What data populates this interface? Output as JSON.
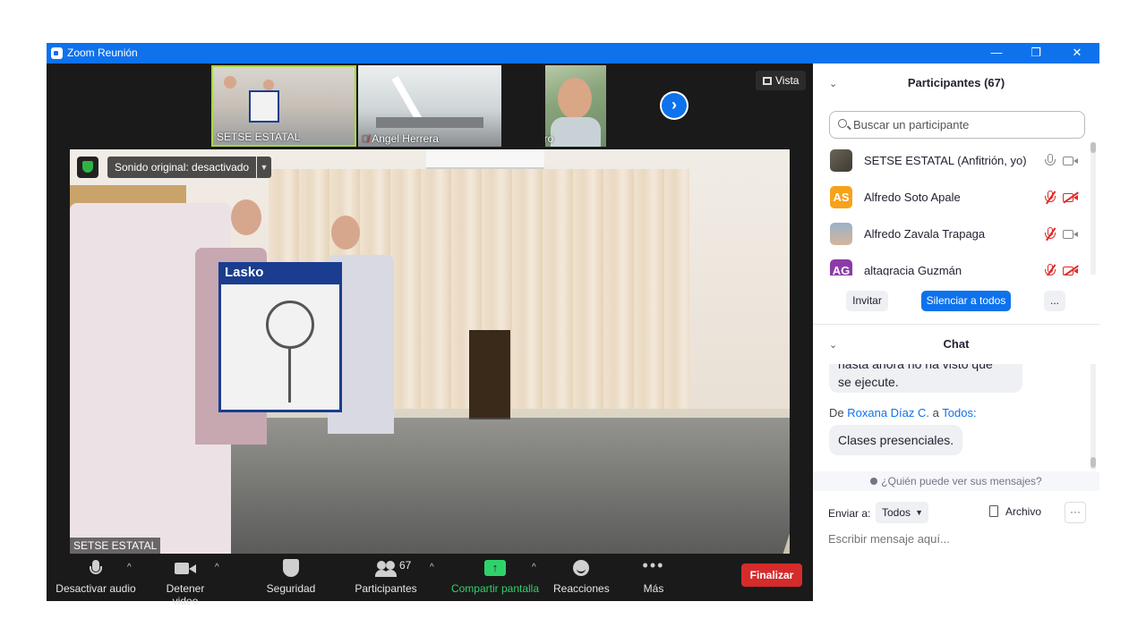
{
  "window": {
    "title": "Zoom Reunión",
    "controls": {
      "minimize": "—",
      "restore": "❐",
      "close": "✕"
    }
  },
  "thumbnails": [
    {
      "name": "SETSE ESTATAL",
      "muted": false,
      "active_speaker": true
    },
    {
      "name": "Angel Herrera",
      "muted": true
    },
    {
      "name": "Pedro",
      "muted": true
    }
  ],
  "next_page_icon": "chevron-right-icon",
  "view_button": {
    "label": "Vista",
    "icon": "grid-icon"
  },
  "main_video": {
    "name": "SETSE ESTATAL",
    "sound_original": "Sonido original: desactivado",
    "box_brand": "Lasko"
  },
  "toolbar": {
    "mute_label": "Desactivar audio",
    "video_label": "Detener video",
    "security_label": "Seguridad",
    "participants_label": "Participantes",
    "participants_count": "67",
    "share_label": "Compartir pantalla",
    "reactions_label": "Reacciones",
    "more_label": "Más",
    "end_label": "Finalizar",
    "share_color": "#2fd26a",
    "end_color": "#d52b2b"
  },
  "participants_panel": {
    "title": "Participantes (67)",
    "search_placeholder": "Buscar un participante",
    "list": [
      {
        "name": "SETSE ESTATAL (Anfitrión, yo)",
        "initials": "",
        "avatar": "photo",
        "mic_muted": false,
        "video_off": false
      },
      {
        "name": "Alfredo Soto Apale",
        "initials": "AS",
        "avatar_color": "#f7a21a",
        "mic_muted": true,
        "video_off": true
      },
      {
        "name": "Alfredo Zavala Trapaga",
        "initials": "",
        "avatar": "photo",
        "mic_muted": true,
        "video_off": false
      },
      {
        "name": "altagracia Guzmán",
        "initials": "AG",
        "avatar_color": "#8b3ba8",
        "mic_muted": true,
        "video_off": true
      }
    ],
    "invite_label": "Invitar",
    "mute_all_label": "Silenciar a todos",
    "more_label": "..."
  },
  "chat_panel": {
    "title": "Chat",
    "partial_message_line1": "hasta ahora no ha visto que",
    "partial_message_line2": "se ejecute.",
    "from_prefix": "De",
    "from_sender": "Roxana Díaz C.",
    "from_mid": "a",
    "from_recipient": "Todos:",
    "last_message": "Clases presenciales.",
    "who_can_see": "¿Quién puede ver sus mensajes?",
    "send_to_label": "Enviar a:",
    "send_to_value": "Todos",
    "file_label": "Archivo",
    "more_label": "···",
    "input_placeholder": "Escribir mensaje aquí..."
  }
}
